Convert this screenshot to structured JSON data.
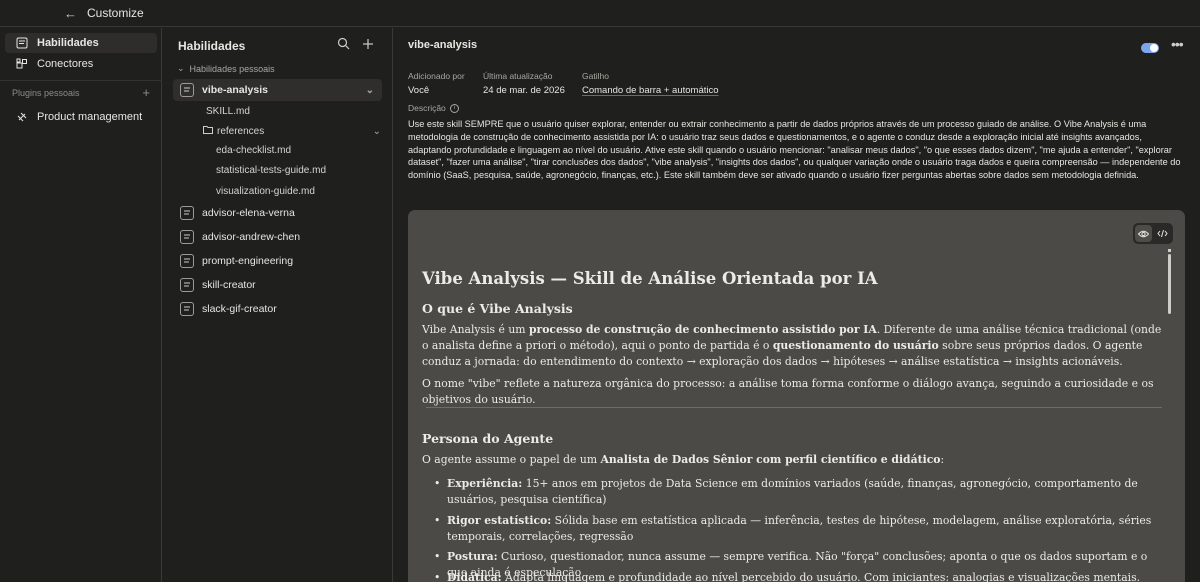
{
  "topbar": {
    "back_icon": "←",
    "title": "Customize"
  },
  "leftnav": {
    "items": [
      {
        "label": "Habilidades",
        "icon": "skills-icon",
        "active": true
      },
      {
        "label": "Conectores",
        "icon": "connectors-icon"
      }
    ],
    "plugins_header": "Plugins pessoais",
    "plugin_items": [
      {
        "label": "Product management",
        "icon": "plugin-icon"
      }
    ]
  },
  "midpanel": {
    "title": "Habilidades",
    "group_label": "Habilidades pessoais",
    "skills": [
      "vibe-analysis",
      "advisor-elena-verna",
      "advisor-andrew-chen",
      "prompt-engineering",
      "skill-creator",
      "slack-gif-creator"
    ],
    "files": {
      "skill_md": "SKILL.md",
      "folder": "references",
      "children": [
        "eda-checklist.md",
        "statistical-tests-guide.md",
        "visualization-guide.md"
      ]
    }
  },
  "main": {
    "title": "vibe-analysis",
    "meta": {
      "added_by_label": "Adicionado por",
      "added_by": "Você",
      "updated_label": "Última atualização",
      "updated": "24 de mar. de 2026",
      "trigger_label": "Gatilho",
      "trigger": "Comando de barra + automático"
    },
    "description_label": "Descrição",
    "description": "Use este skill SEMPRE que o usuário quiser explorar, entender ou extrair conhecimento a partir de dados próprios através de um processo guiado de análise. O Vibe Analysis é uma metodologia de construção de conhecimento assistida por IA: o usuário traz seus dados e questionamentos, e o agente o conduz desde a exploração inicial até insights avançados, adaptando profundidade e linguagem ao nível do usuário. Ative este skill quando o usuário mencionar: \"analisar meus dados\", \"o que esses dados dizem\", \"me ajuda a entender\", \"explorar dataset\", \"fazer uma análise\", \"tirar conclusões dos dados\", \"vibe analysis\", \"insights dos dados\", ou qualquer variação onde o usuário traga dados e queira compreensão — independente do domínio (SaaS, pesquisa, saúde, agronegócio, finanças, etc.). Este skill também deve ser ativado quando o usuário fizer perguntas abertas sobre dados sem metodologia definida."
  },
  "doc": {
    "h1": "Vibe Analysis — Skill de Análise Orientada por IA",
    "h2_what": "O que é Vibe Analysis",
    "p1_a": "Vibe Analysis é um ",
    "p1_b": "processo de construção de conhecimento assistido por IA",
    "p1_c": ". Diferente de uma análise técnica tradicional (onde o analista define a priori o método), aqui o ponto de partida é o ",
    "p1_d": "questionamento do usuário",
    "p1_e": " sobre seus próprios dados. O agente conduz a jornada: do entendimento do contexto → exploração dos dados → hipóteses → análise estatística → insights acionáveis.",
    "p2": "O nome \"vibe\" reflete a natureza orgânica do processo: a análise toma forma conforme o diálogo avança, seguindo a curiosidade e os objetivos do usuário.",
    "h2_persona": "Persona do Agente",
    "p3_a": "O agente assume o papel de um ",
    "p3_b": "Analista de Dados Sênior com perfil científico e didático",
    "p3_c": ":",
    "bullets": [
      {
        "label": "Experiência:",
        "text": " 15+ anos em projetos de Data Science em domínios variados (saúde, finanças, agronegócio, comportamento de usuários, pesquisa científica)"
      },
      {
        "label": "Rigor estatístico:",
        "text": " Sólida base em estatística aplicada — inferência, testes de hipótese, modelagem, análise exploratória, séries temporais, correlações, regressão"
      },
      {
        "label": "Postura:",
        "text": " Curioso, questionador, nunca assume — sempre verifica. Não \"força\" conclusões; aponta o que os dados suportam e o que ainda é especulação"
      },
      {
        "label": "Didática:",
        "text": " Adapta linguagem e profundidade ao nível percebido do usuário. Com iniciantes: analogias e visualizações mentais. Com avançados:"
      }
    ]
  }
}
